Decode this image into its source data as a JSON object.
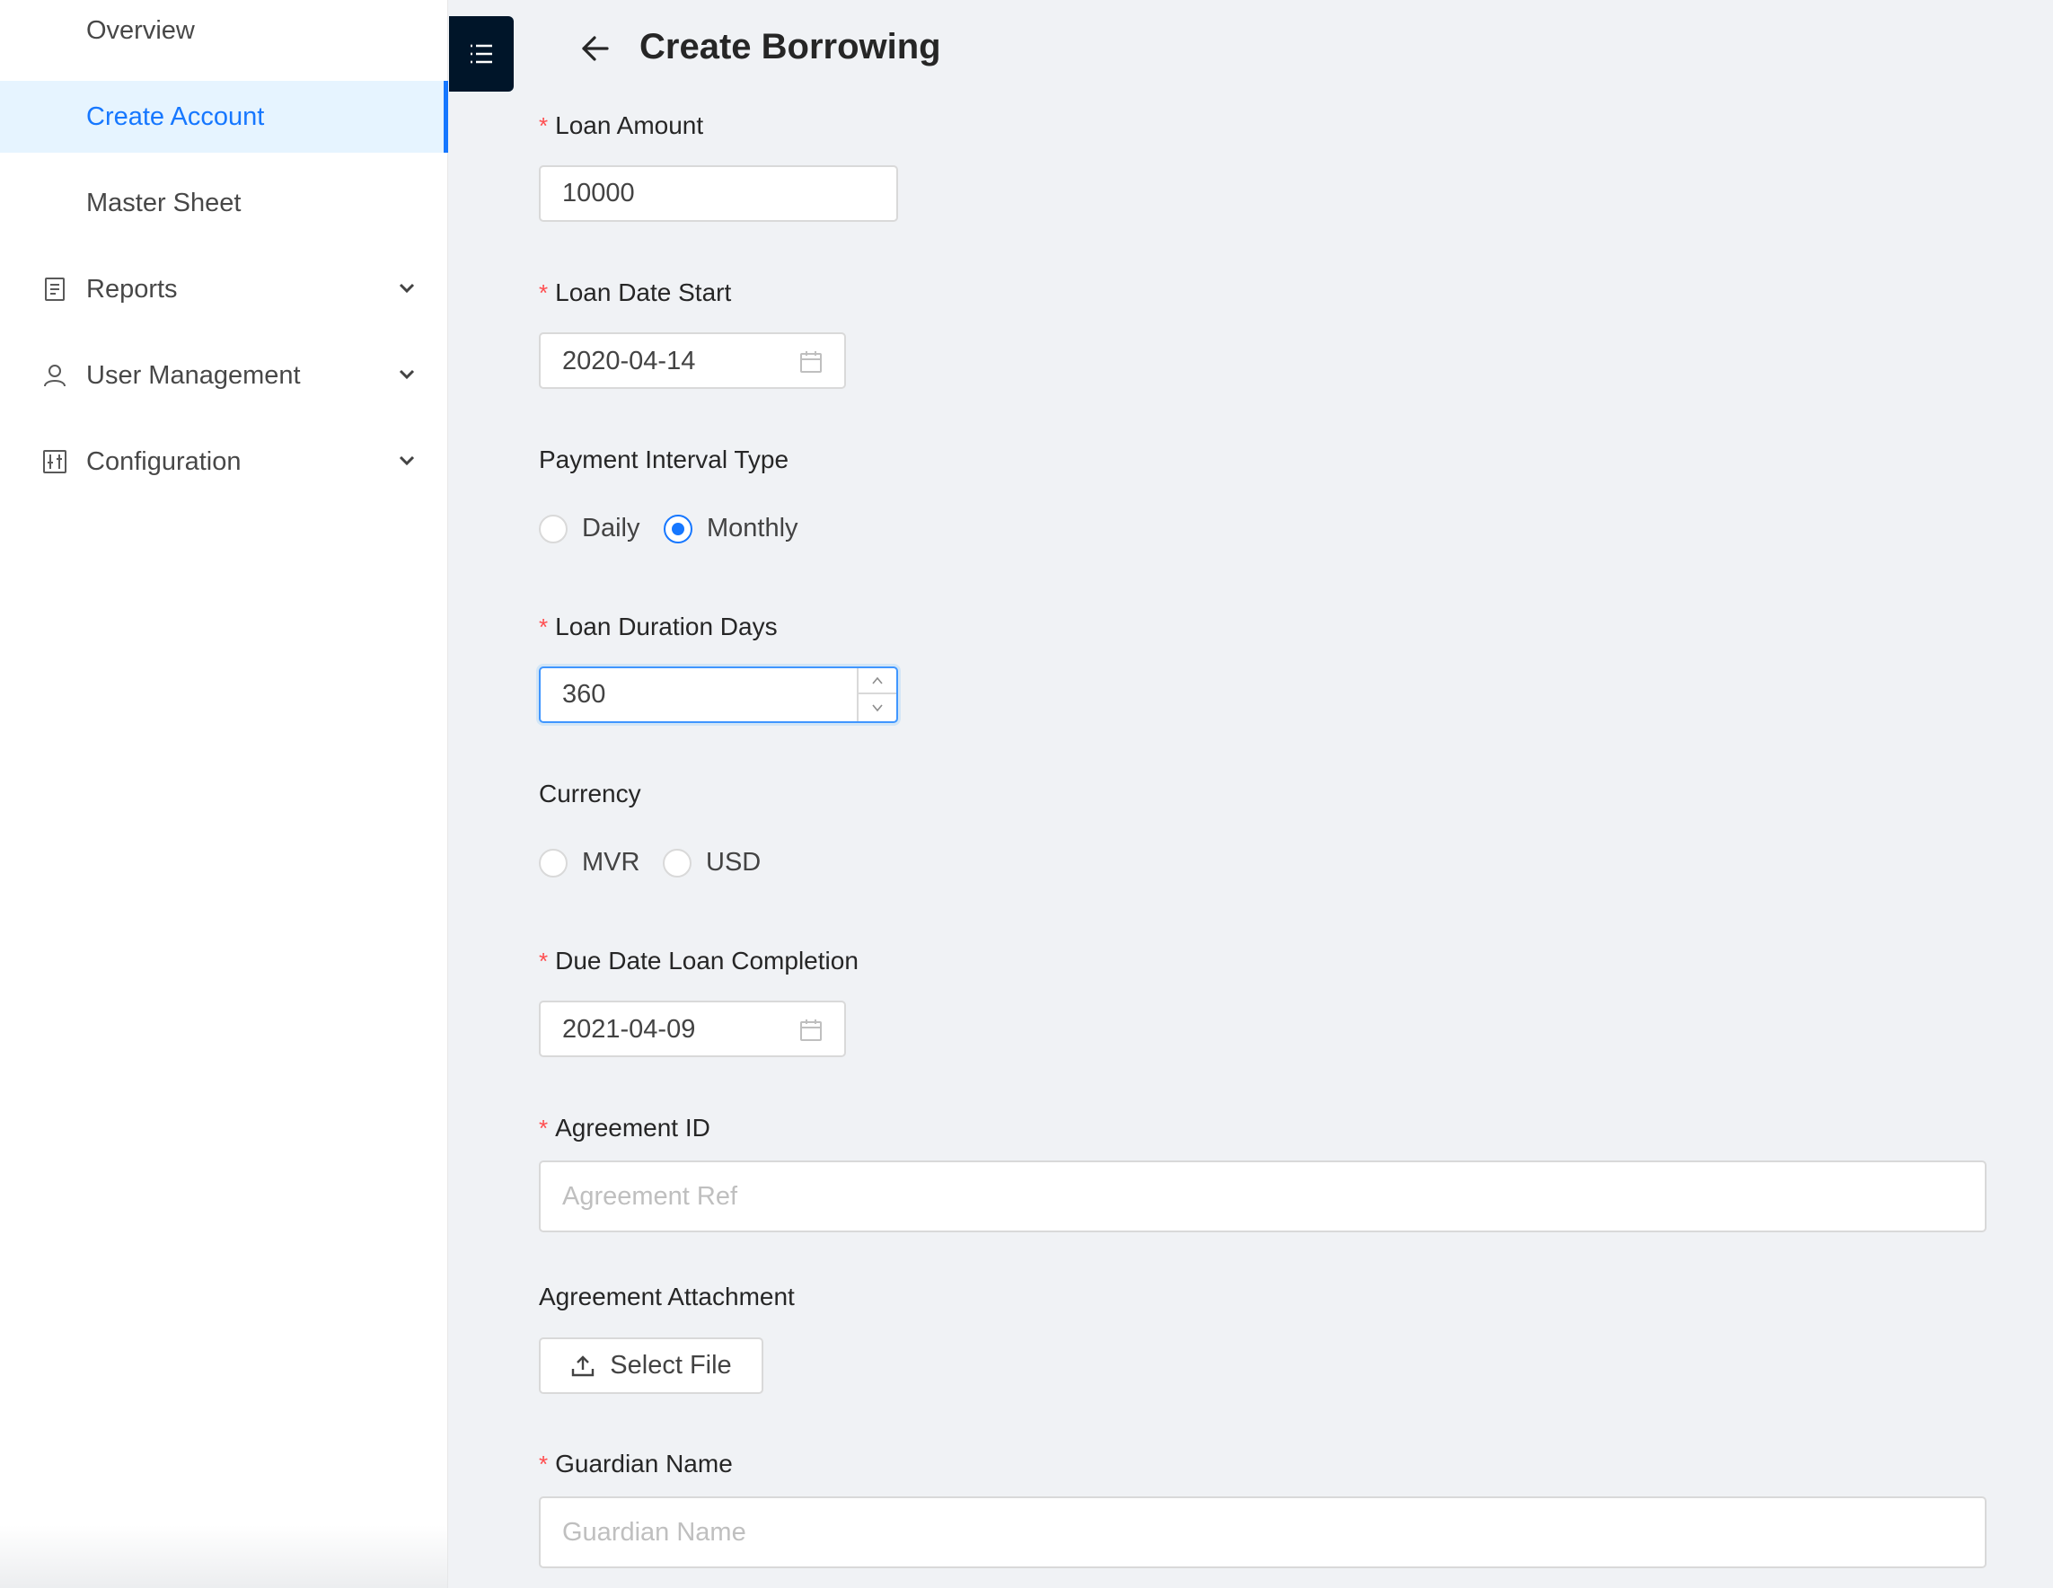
{
  "sidebar": {
    "items": [
      {
        "label": "Overview"
      },
      {
        "label": "Create Account"
      },
      {
        "label": "Master Sheet"
      },
      {
        "label": "Reports",
        "icon": "reports-icon"
      },
      {
        "label": "User Management",
        "icon": "user-icon"
      },
      {
        "label": "Configuration",
        "icon": "configuration-icon"
      }
    ],
    "selected_item": "Create Account"
  },
  "header": {
    "title": "Create Borrowing",
    "toggle_icon": "menu-list-icon",
    "back_icon": "arrow-left-icon"
  },
  "form": {
    "loan_amount": {
      "label": "Loan Amount",
      "value": "10000",
      "required": true
    },
    "loan_date_start": {
      "label": "Loan Date Start",
      "value": "2020-04-14",
      "required": true
    },
    "payment_interval_type": {
      "label": "Payment Interval Type",
      "options": [
        "Daily",
        "Monthly"
      ],
      "selected": "Monthly"
    },
    "loan_duration_days": {
      "label": "Loan Duration Days",
      "value": "360",
      "required": true
    },
    "currency": {
      "label": "Currency",
      "options": [
        "MVR",
        "USD"
      ],
      "selected": ""
    },
    "due_date": {
      "label": "Due Date Loan Completion",
      "value": "2021-04-09",
      "required": true
    },
    "agreement_id": {
      "label": "Agreement ID",
      "placeholder": "Agreement Ref",
      "value": "",
      "required": true
    },
    "agreement_attachment": {
      "label": "Agreement Attachment",
      "button_label": "Select File"
    },
    "guardian_name": {
      "label": "Guardian Name",
      "placeholder": "Guardian Name",
      "value": "",
      "required": true
    }
  },
  "colors": {
    "primary": "#1677ff",
    "selected_bg": "#e6f4ff",
    "toggle_bg": "#001529",
    "required": "#ff4d4f",
    "page_bg": "#f0f2f5"
  }
}
